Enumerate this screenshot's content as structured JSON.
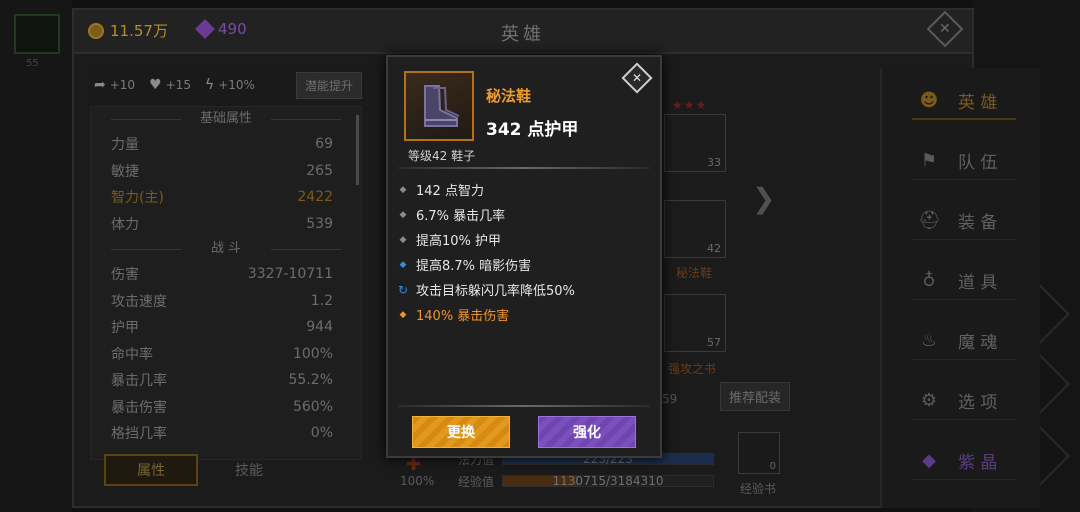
{
  "currency": {
    "gold": "11.57万",
    "gems": "490"
  },
  "header": {
    "title": "英雄",
    "close_icon": "close-icon"
  },
  "edge": {
    "level": "55"
  },
  "buffs": [
    {
      "icon": "armor-icon",
      "value": "+10"
    },
    {
      "icon": "heart-icon",
      "value": "+15"
    },
    {
      "icon": "lightning-icon",
      "value": "+10%"
    }
  ],
  "potential_button": "潜能提升",
  "sections": {
    "basic": "基础属性",
    "combat": "战 斗"
  },
  "basic_stats": [
    {
      "label": "力量",
      "value": "69"
    },
    {
      "label": "敏捷",
      "value": "265"
    },
    {
      "label": "智力(主)",
      "value": "2422"
    },
    {
      "label": "体力",
      "value": "539"
    }
  ],
  "combat_stats": [
    {
      "label": "伤害",
      "value": "3327-10711"
    },
    {
      "label": "攻击速度",
      "value": "1.2"
    },
    {
      "label": "护甲",
      "value": "944"
    },
    {
      "label": "命中率",
      "value": "100%"
    },
    {
      "label": "暴击几率",
      "value": "55.2%"
    },
    {
      "label": "暴击伤害",
      "value": "560%"
    },
    {
      "label": "格挡几率",
      "value": "0%"
    }
  ],
  "left_tabs": {
    "attributes": "属性",
    "skills": "技能"
  },
  "center": {
    "slot_top_level": "33",
    "boots_level": "42",
    "boots_label": "秘法鞋",
    "book_level": "57",
    "book_label": "强攻之书",
    "partial_num": "59",
    "recommend": "推荐配装",
    "mana_label": "法力值",
    "mana_value": "223/223",
    "mana_fraction": 1.0,
    "exp_label": "经验值",
    "exp_value": "1130715/3184310",
    "exp_fraction": 0.355,
    "pct": "100%",
    "exp_book_count": "0",
    "exp_book_label": "经验书"
  },
  "nav": [
    {
      "icon": "heroes-icon",
      "label": "英 雄"
    },
    {
      "icon": "flag-icon",
      "label": "队 伍"
    },
    {
      "icon": "helmet-icon",
      "label": "装 备"
    },
    {
      "icon": "bag-icon",
      "label": "道 具"
    },
    {
      "icon": "flame-icon",
      "label": "魔 魂"
    },
    {
      "icon": "gear-icon",
      "label": "选 项"
    },
    {
      "icon": "crystal-icon",
      "label": "紫 晶"
    }
  ],
  "popup": {
    "item_name": "秘法鞋",
    "armor": "342 点护甲",
    "sub": "等级42 鞋子",
    "attributes": [
      {
        "type": "normal",
        "text": "142 点智力"
      },
      {
        "type": "normal",
        "text": "6.7% 暴击几率"
      },
      {
        "type": "normal",
        "text": "提高10% 护甲"
      },
      {
        "type": "blue",
        "text": "提高8.7% 暗影伤害"
      },
      {
        "type": "cycle",
        "text": "攻击目标躲闪几率降低50%"
      },
      {
        "type": "orange",
        "text": "140% 暴击伤害"
      }
    ],
    "replace_button": "更换",
    "upgrade_button": "强化"
  },
  "colors": {
    "item_name": "#f19a2a",
    "legendary": "#f0932a",
    "magic": "#3a8ad8",
    "replace": "#d78a12",
    "upgrade": "#6f45b0"
  }
}
